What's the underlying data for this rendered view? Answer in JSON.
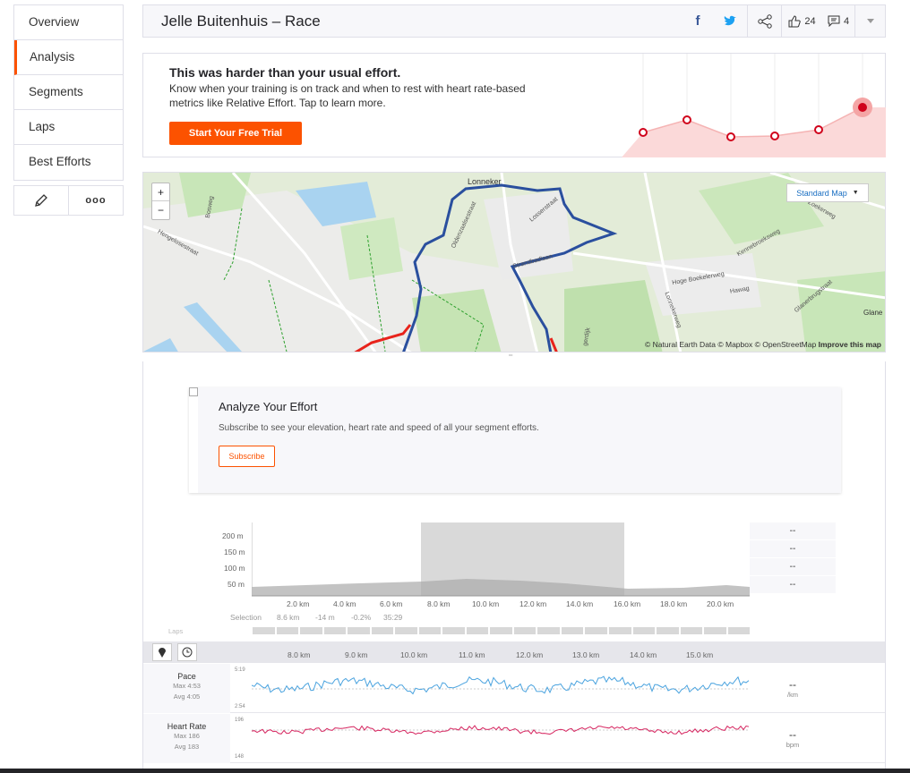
{
  "sidebar": {
    "items": [
      {
        "label": "Overview"
      },
      {
        "label": "Analysis"
      },
      {
        "label": "Segments"
      },
      {
        "label": "Laps"
      },
      {
        "label": "Best Efforts"
      }
    ],
    "active": "Analysis"
  },
  "header": {
    "title": "Jelle Buitenhuis – Race",
    "kudos_count": "24",
    "comment_count": "4"
  },
  "promo": {
    "headline": "This was harder than your usual effort.",
    "body": "Know when your training is on track and when to rest with heart rate-based metrics like Relative Effort. Tap to learn more.",
    "cta": "Start Your Free Trial"
  },
  "map": {
    "style_label": "Standard Map",
    "zoom_in": "+",
    "zoom_out": "−",
    "attribution": "© Natural Earth Data © Mapbox © OpenStreetMap",
    "improve": "Improve this map",
    "labels": {
      "lonneker": "Lonneker",
      "glane": "Glane",
      "hoge_boekelerweg": "Hoge Boekelerweg",
      "hawag": "Hawag",
      "bosweg": "Bosweg",
      "hengelosestraat": "Hengelosestraat",
      "zoekerweg": "Zoekerweg",
      "kennebroeksweg": "Kennebroeksweg",
      "glanerbrugstraat": "Glanerbrugstraat",
      "lonnekerweg": "Lonnekerweg",
      "gerdijk": "gerdijk",
      "losserstraat": "Losserstraat",
      "oldenzaalsestraat": "Oldenzaalsestraat",
      "strandbadlaan": "Strandbadlaan"
    }
  },
  "upsell": {
    "title": "Analyze Your Effort",
    "body": "Subscribe to see your elevation, heart rate and speed of all your segment efforts.",
    "button": "Subscribe"
  },
  "elevation": {
    "y_ticks": [
      "200 m",
      "150 m",
      "100 m",
      "50 m"
    ],
    "x_ticks": [
      "2.0 km",
      "4.0 km",
      "6.0 km",
      "8.0 km",
      "10.0 km",
      "12.0 km",
      "14.0 km",
      "16.0 km",
      "18.0 km",
      "20.0 km"
    ],
    "stats": [
      "--",
      "--",
      "--",
      "--"
    ],
    "selection_label": "Selection",
    "selection_values": [
      "8.6 km",
      "-14 m",
      "-0.2%",
      "35:29"
    ],
    "laps_label": "Laps"
  },
  "detail": {
    "x_ticks": [
      "8.0 km",
      "9.0 km",
      "10.0 km",
      "11.0 km",
      "12.0 km",
      "13.0 km",
      "14.0 km",
      "15.0 km"
    ],
    "metrics": [
      {
        "name": "Pace",
        "max": "Max 4:53",
        "avg": "Avg 4:05",
        "top": "5:19",
        "bottom": "2:54",
        "value": "--",
        "unit": "/km",
        "color": "#4aa3df"
      },
      {
        "name": "Heart Rate",
        "max": "Max 186",
        "avg": "Avg 183",
        "top": "196",
        "bottom": "148",
        "value": "--",
        "unit": "bpm",
        "color": "#d6245f"
      }
    ]
  },
  "colors": {
    "accent": "#fc5200",
    "route": "#2a4f9e",
    "route_highlight": "#e8231b"
  }
}
